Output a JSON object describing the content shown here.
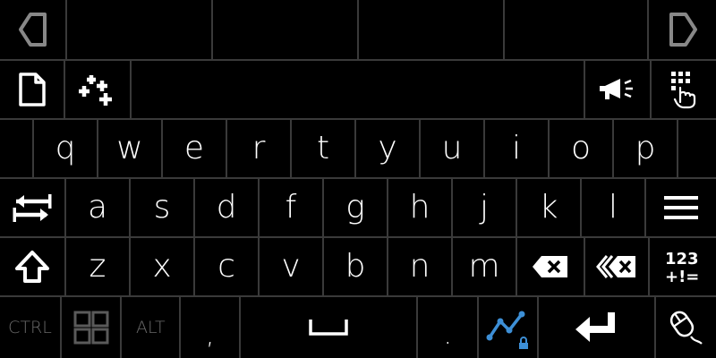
{
  "row1": {
    "left_icon": "triangle-left-icon",
    "right_icon": "triangle-right-icon",
    "suggestions": [
      "",
      "",
      "",
      ""
    ]
  },
  "row2": {
    "left_icons": [
      "document-icon",
      "plus-cluster-icon"
    ],
    "right_icons": [
      "megaphone-icon",
      "keypad-hand-icon"
    ]
  },
  "row3": {
    "keys": [
      "q",
      "w",
      "e",
      "r",
      "t",
      "y",
      "u",
      "i",
      "o",
      "p"
    ]
  },
  "row4": {
    "keys": [
      "a",
      "s",
      "d",
      "f",
      "g",
      "h",
      "j",
      "k",
      "l"
    ],
    "left_icon": "tab-arrows-icon",
    "right_icon": "menu-icon"
  },
  "row5": {
    "keys": [
      "z",
      "x",
      "c",
      "v",
      "b",
      "n",
      "m"
    ],
    "left_icon": "shift-icon",
    "right_icons": [
      "backspace-icon",
      "delete-word-icon",
      "numbers-symbols-icon"
    ]
  },
  "row6": {
    "ctrl": "CTRL",
    "alt": "ALT",
    "comma": ",",
    "period": ".",
    "icons": [
      "windows-icon",
      "space-bar-icon",
      "graph-lock-icon",
      "enter-icon",
      "mouse-icon"
    ]
  },
  "colors": {
    "background": "#000000",
    "border": "#3a3a3a",
    "accent": "#3d8fd6",
    "dim": "#6a6a6a"
  }
}
